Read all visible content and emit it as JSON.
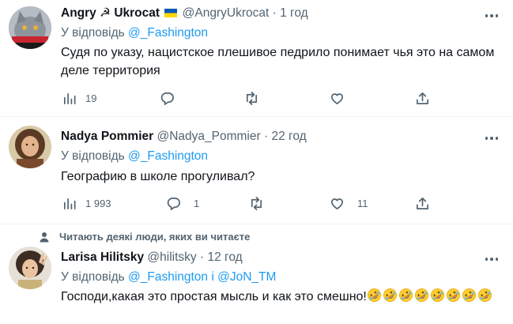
{
  "tweets": [
    {
      "name_a": "Angry",
      "name_sym": "☭",
      "name_b": "Ukrocat",
      "handle": "@AngryUkrocat",
      "time": "1 год",
      "reply_prefix": "У відповідь",
      "reply_to": "@_Fashington",
      "text": "Судя по указу, нацистское плешивое педрило понимает чья это на самом деле территория",
      "views": "19"
    },
    {
      "name": "Nadya Pommier",
      "handle": "@Nadya_Pommier",
      "time": "22 год",
      "reply_prefix": "У відповідь",
      "reply_to": "@_Fashington",
      "text": "Географию в школе прогуливал?",
      "views": "1 993",
      "replies": "1",
      "likes": "11"
    },
    {
      "social_context": "Читають деякі люди, яких ви читаєте",
      "name": "Larisa Hilitsky",
      "handle": "@hilitsky",
      "time": "12 год",
      "reply_prefix": "У відповідь",
      "reply_to": "@_Fashington",
      "reply_and": "і",
      "reply_to_2": "@JoN_TM",
      "text": "Господи,какая это простая мысль и как это смешно!",
      "emoji": "rolling-on-floor-laughing",
      "emoji_count": 8
    }
  ],
  "separator": "·",
  "colors": {
    "link": "#1d9bf0",
    "secondary": "#536471",
    "text": "#0f1419",
    "flag_blue": "#0057b7",
    "flag_yellow": "#ffd700"
  }
}
